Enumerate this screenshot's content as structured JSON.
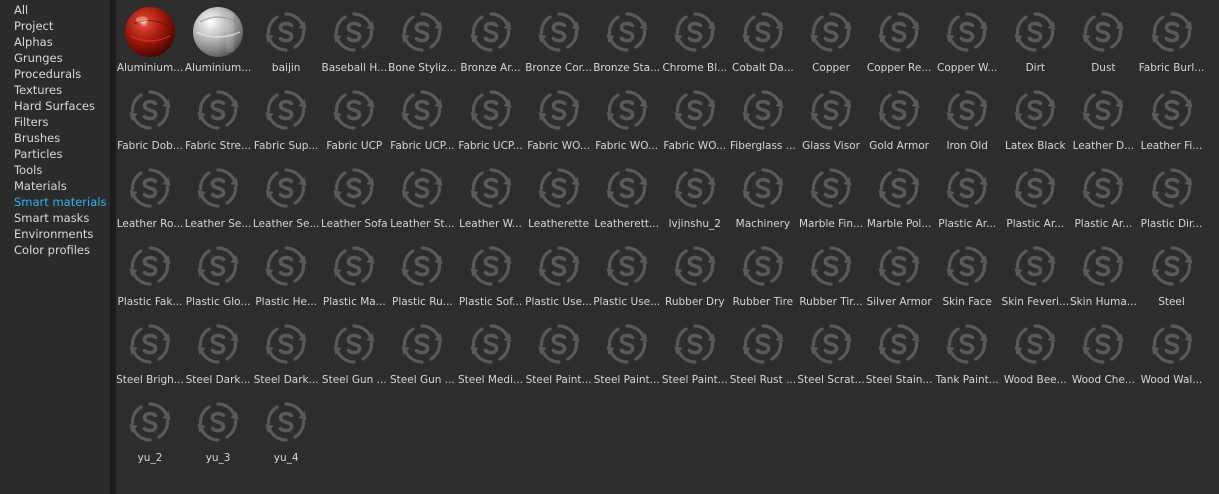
{
  "sidebar": {
    "selected_index": 11,
    "items": [
      {
        "label": "All"
      },
      {
        "label": "Project"
      },
      {
        "label": "Alphas"
      },
      {
        "label": "Grunges"
      },
      {
        "label": "Procedurals"
      },
      {
        "label": "Textures"
      },
      {
        "label": "Hard Surfaces"
      },
      {
        "label": "Filters"
      },
      {
        "label": "Brushes"
      },
      {
        "label": "Particles"
      },
      {
        "label": "Tools"
      },
      {
        "label": "Materials"
      },
      {
        "label": "Smart materials"
      },
      {
        "label": "Smart masks"
      },
      {
        "label": "Environments"
      },
      {
        "label": "Color profiles"
      }
    ]
  },
  "colors": {
    "selected_text": "#2fb5ee",
    "text": "#d9d9d9",
    "placeholder_icon": "#5a5a5a"
  },
  "assets": [
    {
      "label": "Aluminium...",
      "icon": "red-sphere-preview"
    },
    {
      "label": "Aluminium...",
      "icon": "silver-sphere-preview"
    },
    {
      "label": "baijin",
      "icon": "loading-refresh-icon"
    },
    {
      "label": "Baseball H...",
      "icon": "loading-refresh-icon"
    },
    {
      "label": "Bone Styliz...",
      "icon": "loading-refresh-icon"
    },
    {
      "label": "Bronze Ar...",
      "icon": "loading-refresh-icon"
    },
    {
      "label": "Bronze Cor...",
      "icon": "loading-refresh-icon"
    },
    {
      "label": "Bronze Sta...",
      "icon": "loading-refresh-icon"
    },
    {
      "label": "Chrome Bl...",
      "icon": "loading-refresh-icon"
    },
    {
      "label": "Cobalt Da...",
      "icon": "loading-refresh-icon"
    },
    {
      "label": "Copper",
      "icon": "loading-refresh-icon"
    },
    {
      "label": "Copper Re...",
      "icon": "loading-refresh-icon"
    },
    {
      "label": "Copper W...",
      "icon": "loading-refresh-icon"
    },
    {
      "label": "Dirt",
      "icon": "loading-refresh-icon"
    },
    {
      "label": "Dust",
      "icon": "loading-refresh-icon"
    },
    {
      "label": "Fabric Burl...",
      "icon": "loading-refresh-icon"
    },
    {
      "label": "Fabric Dob...",
      "icon": "loading-refresh-icon"
    },
    {
      "label": "Fabric Stre...",
      "icon": "loading-refresh-icon"
    },
    {
      "label": "Fabric Sup...",
      "icon": "loading-refresh-icon"
    },
    {
      "label": "Fabric UCP",
      "icon": "loading-refresh-icon"
    },
    {
      "label": "Fabric UCP...",
      "icon": "loading-refresh-icon"
    },
    {
      "label": "Fabric UCP...",
      "icon": "loading-refresh-icon"
    },
    {
      "label": "Fabric WO...",
      "icon": "loading-refresh-icon"
    },
    {
      "label": "Fabric WO...",
      "icon": "loading-refresh-icon"
    },
    {
      "label": "Fabric WO...",
      "icon": "loading-refresh-icon"
    },
    {
      "label": "Fiberglass ...",
      "icon": "loading-refresh-icon"
    },
    {
      "label": "Glass Visor",
      "icon": "loading-refresh-icon"
    },
    {
      "label": "Gold Armor",
      "icon": "loading-refresh-icon"
    },
    {
      "label": "Iron Old",
      "icon": "loading-refresh-icon"
    },
    {
      "label": "Latex Black",
      "icon": "loading-refresh-icon"
    },
    {
      "label": "Leather D...",
      "icon": "loading-refresh-icon"
    },
    {
      "label": "Leather Fi...",
      "icon": "loading-refresh-icon"
    },
    {
      "label": "Leather Ro...",
      "icon": "loading-refresh-icon"
    },
    {
      "label": "Leather Se...",
      "icon": "loading-refresh-icon"
    },
    {
      "label": "Leather Se...",
      "icon": "loading-refresh-icon"
    },
    {
      "label": "Leather Sofa",
      "icon": "loading-refresh-icon"
    },
    {
      "label": "Leather St...",
      "icon": "loading-refresh-icon"
    },
    {
      "label": "Leather W...",
      "icon": "loading-refresh-icon"
    },
    {
      "label": "Leatherette",
      "icon": "loading-refresh-icon"
    },
    {
      "label": "Leatherett...",
      "icon": "loading-refresh-icon"
    },
    {
      "label": "lvjinshu_2",
      "icon": "loading-refresh-icon"
    },
    {
      "label": "Machinery",
      "icon": "loading-refresh-icon"
    },
    {
      "label": "Marble Fin...",
      "icon": "loading-refresh-icon"
    },
    {
      "label": "Marble Pol...",
      "icon": "loading-refresh-icon"
    },
    {
      "label": "Plastic Ar...",
      "icon": "loading-refresh-icon"
    },
    {
      "label": "Plastic Ar...",
      "icon": "loading-refresh-icon"
    },
    {
      "label": "Plastic Ar...",
      "icon": "loading-refresh-icon"
    },
    {
      "label": "Plastic Dir...",
      "icon": "loading-refresh-icon"
    },
    {
      "label": "Plastic Fak...",
      "icon": "loading-refresh-icon"
    },
    {
      "label": "Plastic Glo...",
      "icon": "loading-refresh-icon"
    },
    {
      "label": "Plastic He...",
      "icon": "loading-refresh-icon"
    },
    {
      "label": "Plastic Ma...",
      "icon": "loading-refresh-icon"
    },
    {
      "label": "Plastic Ru...",
      "icon": "loading-refresh-icon"
    },
    {
      "label": "Plastic Sof...",
      "icon": "loading-refresh-icon"
    },
    {
      "label": "Plastic Use...",
      "icon": "loading-refresh-icon"
    },
    {
      "label": "Plastic Use...",
      "icon": "loading-refresh-icon"
    },
    {
      "label": "Rubber Dry",
      "icon": "loading-refresh-icon"
    },
    {
      "label": "Rubber Tire",
      "icon": "loading-refresh-icon"
    },
    {
      "label": "Rubber Tir...",
      "icon": "loading-refresh-icon"
    },
    {
      "label": "Silver Armor",
      "icon": "loading-refresh-icon"
    },
    {
      "label": "Skin Face",
      "icon": "loading-refresh-icon"
    },
    {
      "label": "Skin Feveri...",
      "icon": "loading-refresh-icon"
    },
    {
      "label": "Skin Huma...",
      "icon": "loading-refresh-icon"
    },
    {
      "label": "Steel",
      "icon": "loading-refresh-icon"
    },
    {
      "label": "Steel Brigh...",
      "icon": "loading-refresh-icon"
    },
    {
      "label": "Steel Dark...",
      "icon": "loading-refresh-icon"
    },
    {
      "label": "Steel Dark...",
      "icon": "loading-refresh-icon"
    },
    {
      "label": "Steel Gun ...",
      "icon": "loading-refresh-icon"
    },
    {
      "label": "Steel Gun ...",
      "icon": "loading-refresh-icon"
    },
    {
      "label": "Steel Medi...",
      "icon": "loading-refresh-icon"
    },
    {
      "label": "Steel Paint...",
      "icon": "loading-refresh-icon"
    },
    {
      "label": "Steel Paint...",
      "icon": "loading-refresh-icon"
    },
    {
      "label": "Steel Paint...",
      "icon": "loading-refresh-icon"
    },
    {
      "label": "Steel Rust ...",
      "icon": "loading-refresh-icon"
    },
    {
      "label": "Steel Scrat...",
      "icon": "loading-refresh-icon"
    },
    {
      "label": "Steel Stain...",
      "icon": "loading-refresh-icon"
    },
    {
      "label": "Tank Paint...",
      "icon": "loading-refresh-icon"
    },
    {
      "label": "Wood Bee...",
      "icon": "loading-refresh-icon"
    },
    {
      "label": "Wood Che...",
      "icon": "loading-refresh-icon"
    },
    {
      "label": "Wood Wal...",
      "icon": "loading-refresh-icon"
    },
    {
      "label": "yu_2",
      "icon": "loading-refresh-icon"
    },
    {
      "label": "yu_3",
      "icon": "loading-refresh-icon"
    },
    {
      "label": "yu_4",
      "icon": "loading-refresh-icon"
    }
  ]
}
